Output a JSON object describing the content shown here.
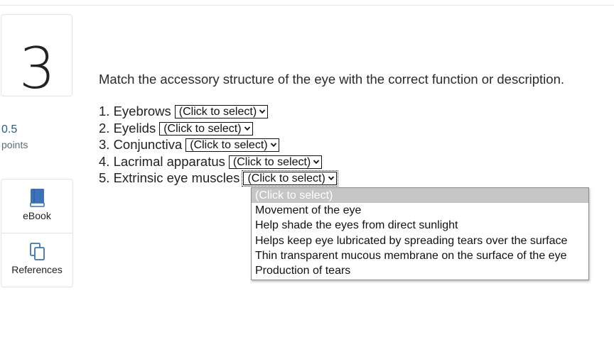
{
  "question_number": "3",
  "points": {
    "value": "0.5",
    "label": "points"
  },
  "tools": [
    {
      "label": "eBook",
      "icon": "book-icon"
    },
    {
      "label": "References",
      "icon": "copy-documents-icon"
    }
  ],
  "question_text": "Match the accessory structure of the eye with the correct function or description.",
  "items": [
    {
      "label": "1. Eyebrows",
      "selected": "(Click to select)"
    },
    {
      "label": "2. Eyelids",
      "selected": "(Click to select)"
    },
    {
      "label": "3. Conjunctiva",
      "selected": "(Click to select)"
    },
    {
      "label": "4. Lacrimal apparatus",
      "selected": "(Click to select)"
    },
    {
      "label": "5. Extrinsic eye muscles",
      "selected": "(Click to select)"
    }
  ],
  "dropdown_options": [
    "(Click to select)",
    "Movement of the eye",
    "Help shade the eyes from direct sunlight",
    "Helps keep eye lubricated by spreading tears over the surface",
    "Thin transparent mucous membrane on the surface of the eye",
    "Production of tears"
  ],
  "colors": {
    "accent": "#3b73b9",
    "points": "#1f5a86",
    "highlight": "#c6c6c6"
  }
}
